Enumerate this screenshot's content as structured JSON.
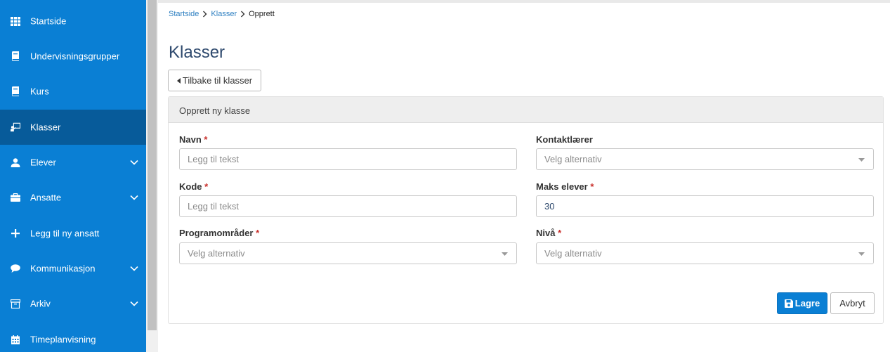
{
  "sidebar": {
    "items": [
      {
        "label": "Startside",
        "icon": "grid-icon"
      },
      {
        "label": "Undervisningsgrupper",
        "icon": "book-icon"
      },
      {
        "label": "Kurs",
        "icon": "book-icon"
      },
      {
        "label": "Klasser",
        "icon": "classroom-icon",
        "active": true
      },
      {
        "label": "Elever",
        "icon": "student-icon",
        "expandable": true
      },
      {
        "label": "Ansatte",
        "icon": "briefcase-icon",
        "expandable": true
      },
      {
        "label": "Legg til ny ansatt",
        "icon": "plus-icon"
      },
      {
        "label": "Kommunikasjon",
        "icon": "chat-bubble-icon",
        "expandable": true
      },
      {
        "label": "Arkiv",
        "icon": "archive-box-icon",
        "expandable": true
      },
      {
        "label": "Timeplanvisning",
        "icon": "calendar-icon"
      }
    ]
  },
  "breadcrumb": {
    "home": "Startside",
    "section": "Klasser",
    "current": "Opprett"
  },
  "page": {
    "title": "Klasser",
    "back_label": "Tilbake til klasser"
  },
  "panel": {
    "title": "Opprett ny klasse"
  },
  "form": {
    "required_mark": "*",
    "name": {
      "label": "Navn",
      "placeholder": "Legg til tekst"
    },
    "code": {
      "label": "Kode",
      "placeholder": "Legg til tekst"
    },
    "programs": {
      "label": "Programområder",
      "placeholder": "Velg alternativ"
    },
    "contact_teacher": {
      "label": "Kontaktlærer",
      "placeholder": "Velg alternativ"
    },
    "max_students": {
      "label": "Maks elever",
      "value": "30"
    },
    "level": {
      "label": "Nivå",
      "placeholder": "Velg alternativ"
    }
  },
  "actions": {
    "save_label": "Lagre",
    "cancel_label": "Avbryt"
  },
  "colors": {
    "sidebar_bg": "#0a7fd4",
    "sidebar_active_bg": "#075b9a",
    "primary_button": "#0a7fd4",
    "link": "#2d7fc1",
    "required": "#c9302c"
  }
}
